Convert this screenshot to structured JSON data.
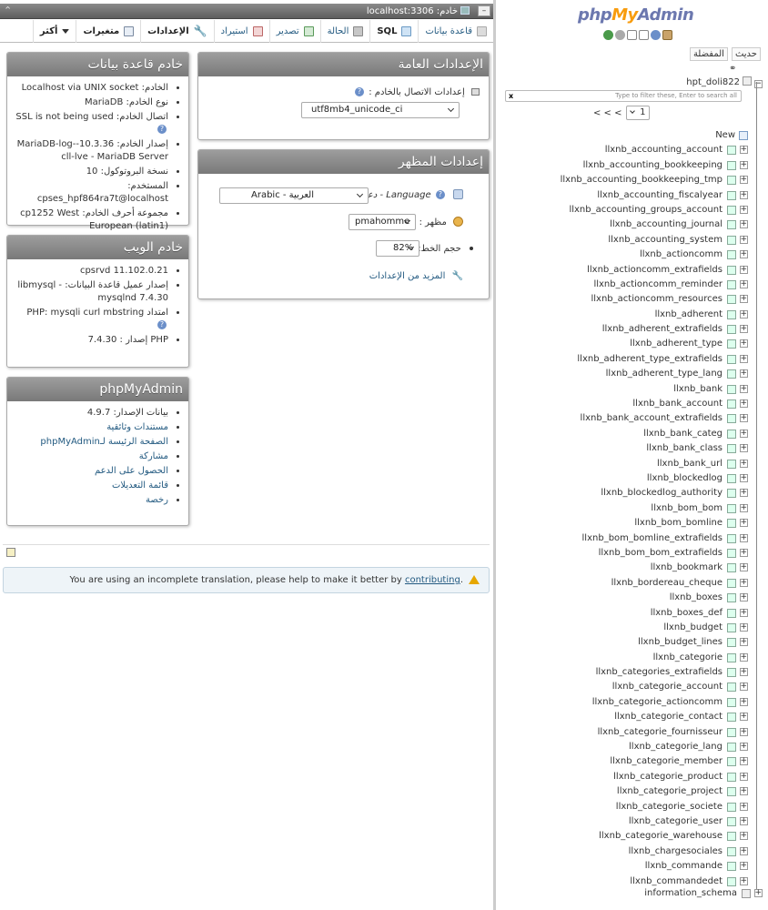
{
  "topbar": {
    "server_crumb": "خادم: localhost:3306",
    "collapse_icon": "double-chevron-up-icon"
  },
  "tabs": [
    {
      "label": "قاعدة بيانات",
      "icon": "database-icon"
    },
    {
      "label": "SQL",
      "icon": "sql-icon"
    },
    {
      "label": "الحالة",
      "icon": "status-icon"
    },
    {
      "label": "تصدير",
      "icon": "export-icon"
    },
    {
      "label": "استيراد",
      "icon": "import-icon"
    },
    {
      "label": "الإعدادات",
      "icon": "wrench-icon"
    },
    {
      "label": "متغيرات",
      "icon": "variables-icon"
    },
    {
      "label": "أكثر",
      "icon": "caret-down-icon"
    }
  ],
  "general_settings": {
    "title": "الإعدادات العامة",
    "collation_label": "إعدادات الاتصال بالخادم :",
    "collation_value": "utf8mb4_unicode_ci"
  },
  "appearance_settings": {
    "title": "إعدادات المظهر",
    "language_label": "Language - دعل",
    "language_value": "Arabic - العربية",
    "theme_label": "مظهر :",
    "theme_value": "pmahomme",
    "font_size_label": "حجم الخط:",
    "font_size_value": "82%",
    "more_settings": "المزيد من الإعدادات"
  },
  "database_server": {
    "title": "خادم قاعدة بيانات",
    "items": [
      "الخادم: Localhost via UNIX socket",
      "نوع الخادم: MariaDB",
      "اتصال الخادم: SSL is not being used",
      "إصدار الخادم: 10.3.36-MariaDB-log-cll-lve - MariaDB Server",
      "نسخة البروتوكول: 10",
      "المستخدم: cpses_hpf864ra7t@localhost",
      "مجموعة أحرف الخادم: cp1252 West European (latin1)"
    ]
  },
  "web_server": {
    "title": "خادم الويب",
    "items": [
      "cpsrvd 11.102.0.21",
      "إصدار عميل قاعدة البيانات: libmysql - mysqlnd 7.4.30",
      "امتداد PHP: mysqli curl mbstring",
      "PHP إصدار : 7.4.30"
    ]
  },
  "phpmyadmin": {
    "title": "phpMyAdmin",
    "items": [
      "بيانات الإصدار: 4.9.7",
      "مستندات وثائقية",
      "الصفحة الرئيسة لـphpMyAdmin",
      "مشاركة",
      "الحصول على الدعم",
      "قائمة التعديلات",
      "رخصة"
    ]
  },
  "notice": {
    "text": "You are using an incomplete translation, please help to make it better by ",
    "link": "contributing",
    "suffix": "."
  },
  "nav": {
    "logo_php": "php",
    "logo_my": "My",
    "logo_admin": "Admin",
    "link_recent": "حديث",
    "link_favorites": "المفضلة",
    "link_chain": "⚭",
    "database": "hpt_doli822",
    "filter_placeholder": "Type to filter these, Enter to search all",
    "filter_clear": "x",
    "pager_prev": "< < <",
    "pager_value": "1",
    "new_label": "New",
    "tables": [
      "llxnb_accounting_account",
      "llxnb_accounting_bookkeeping",
      "llxnb_accounting_bookkeeping_tmp",
      "llxnb_accounting_fiscalyear",
      "llxnb_accounting_groups_account",
      "llxnb_accounting_journal",
      "llxnb_accounting_system",
      "llxnb_actioncomm",
      "llxnb_actioncomm_extrafields",
      "llxnb_actioncomm_reminder",
      "llxnb_actioncomm_resources",
      "llxnb_adherent",
      "llxnb_adherent_extrafields",
      "llxnb_adherent_type",
      "llxnb_adherent_type_extrafields",
      "llxnb_adherent_type_lang",
      "llxnb_bank",
      "llxnb_bank_account",
      "llxnb_bank_account_extrafields",
      "llxnb_bank_categ",
      "llxnb_bank_class",
      "llxnb_bank_url",
      "llxnb_blockedlog",
      "llxnb_blockedlog_authority",
      "llxnb_bom_bom",
      "llxnb_bom_bomline",
      "llxnb_bom_bomline_extrafields",
      "llxnb_bom_bom_extrafields",
      "llxnb_bookmark",
      "llxnb_bordereau_cheque",
      "llxnb_boxes",
      "llxnb_boxes_def",
      "llxnb_budget",
      "llxnb_budget_lines",
      "llxnb_categorie",
      "llxnb_categories_extrafields",
      "llxnb_categorie_account",
      "llxnb_categorie_actioncomm",
      "llxnb_categorie_contact",
      "llxnb_categorie_fournisseur",
      "llxnb_categorie_lang",
      "llxnb_categorie_member",
      "llxnb_categorie_product",
      "llxnb_categorie_project",
      "llxnb_categorie_societe",
      "llxnb_categorie_user",
      "llxnb_categorie_warehouse",
      "llxnb_chargesociales",
      "llxnb_commande",
      "llxnb_commandedet"
    ],
    "bottom_db": "information_schema"
  }
}
